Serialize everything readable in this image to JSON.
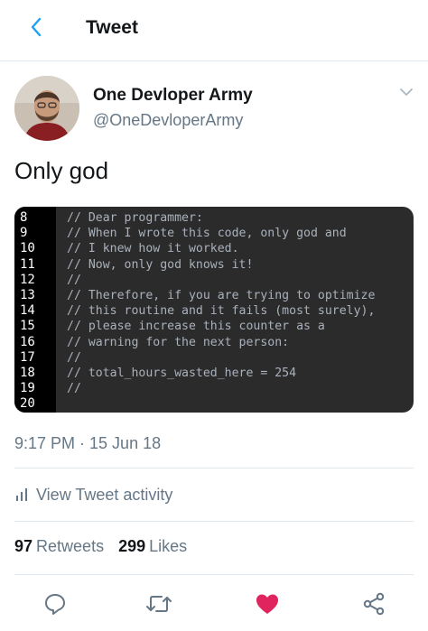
{
  "topbar": {
    "title": "Tweet",
    "back_icon": "chevron-left-icon"
  },
  "author": {
    "name": "One Devloper Army",
    "handle": "@OneDevloperArmy"
  },
  "tweet": {
    "text": "Only god"
  },
  "code": {
    "lines": [
      {
        "num": "8",
        "text": "// Dear programmer:"
      },
      {
        "num": "9",
        "text": "// When I wrote this code, only god and"
      },
      {
        "num": "10",
        "text": "// I knew how it worked."
      },
      {
        "num": "11",
        "text": "// Now, only god knows it!"
      },
      {
        "num": "12",
        "text": "//"
      },
      {
        "num": "13",
        "text": "// Therefore, if you are trying to optimize"
      },
      {
        "num": "14",
        "text": "// this routine and it fails (most surely),"
      },
      {
        "num": "15",
        "text": "// please increase this counter as a"
      },
      {
        "num": "16",
        "text": "// warning for the next person:"
      },
      {
        "num": "17",
        "text": "//"
      },
      {
        "num": "18",
        "text": "// total_hours_wasted_here = 254"
      },
      {
        "num": "19",
        "text": "//"
      },
      {
        "num": "20",
        "text": ""
      }
    ]
  },
  "meta": {
    "timestamp": "9:17 PM · 15 Jun 18",
    "activity_label": "View Tweet activity"
  },
  "stats": {
    "retweets_count": "97",
    "retweets_label": "Retweets",
    "likes_count": "299",
    "likes_label": "Likes"
  },
  "colors": {
    "accent": "#1da1f2",
    "like": "#e0245e",
    "muted": "#657786",
    "code_bg": "#2b2b2b"
  }
}
